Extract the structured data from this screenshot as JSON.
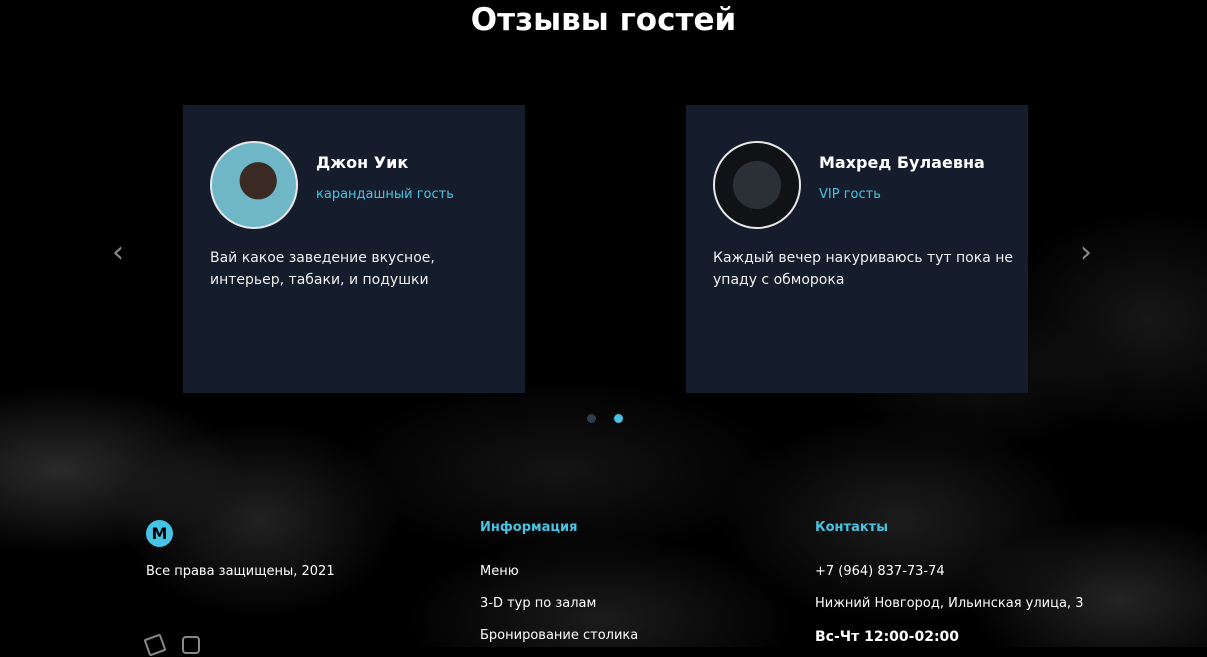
{
  "section_title": "Отзывы гостей",
  "reviews": [
    {
      "name": "Джон Уик",
      "role": "карандашный гость",
      "text": "Вай какое заведение вкусное, интерьер, табаки, и подушки"
    },
    {
      "name": "Махред Булаевна",
      "role": "VIP гость",
      "text": "Каждый вечер накуриваюсь тут пока не упаду с обморока"
    }
  ],
  "carousel": {
    "prev": "‹",
    "next": "›"
  },
  "footer": {
    "logo": "M",
    "copyright": "Все права защищены, 2021",
    "info": {
      "title": "Информация",
      "links": [
        "Меню",
        "3-D тур по залам",
        "Бронирование столика"
      ]
    },
    "contacts": {
      "title": "Контакты",
      "phone": "+7 (964) 837-73-74",
      "address": "Нижний Новгород, Ильинская улица, 3",
      "hours": "Вс-Чт 12:00-02:00"
    }
  },
  "colors": {
    "accent": "#49c3e3",
    "card_bg": "#151c2b"
  }
}
